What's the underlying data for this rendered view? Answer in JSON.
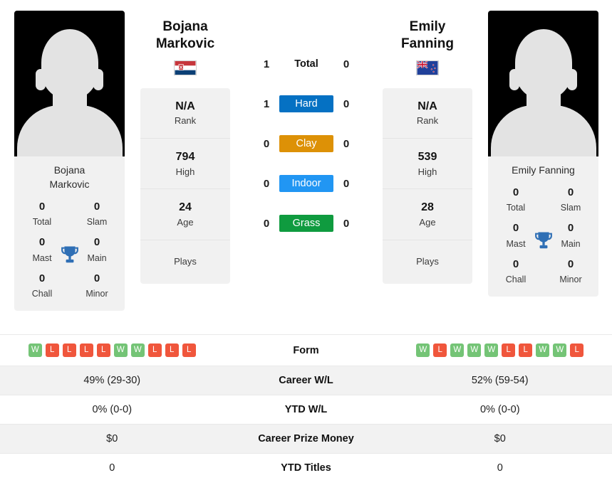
{
  "players": {
    "left": {
      "display_name": "Bojana Markovic",
      "first_name": "Bojana",
      "last_name": "Markovic",
      "photo_caption_line1": "Bojana",
      "photo_caption_line2": "Markovic",
      "flag": "serbia-flag",
      "rank": "N/A",
      "rank_label": "Rank",
      "high": "794",
      "high_label": "High",
      "age": "24",
      "age_label": "Age",
      "plays_label": "Plays",
      "titles": {
        "total": "0",
        "total_label": "Total",
        "slam": "0",
        "slam_label": "Slam",
        "mast": "0",
        "mast_label": "Mast",
        "main": "0",
        "main_label": "Main",
        "chall": "0",
        "chall_label": "Chall",
        "minor": "0",
        "minor_label": "Minor"
      },
      "form": [
        "W",
        "L",
        "L",
        "L",
        "L",
        "W",
        "W",
        "L",
        "L",
        "L"
      ],
      "career_wl": "49% (29-30)",
      "ytd_wl": "0% (0-0)",
      "career_prize_money": "$0",
      "ytd_titles": "0"
    },
    "right": {
      "display_name": "Emily Fanning",
      "first_name": "Emily",
      "last_name": "Fanning",
      "photo_caption_line1": "Emily Fanning",
      "flag": "new-zealand-flag",
      "rank": "N/A",
      "rank_label": "Rank",
      "high": "539",
      "high_label": "High",
      "age": "28",
      "age_label": "Age",
      "plays_label": "Plays",
      "titles": {
        "total": "0",
        "total_label": "Total",
        "slam": "0",
        "slam_label": "Slam",
        "mast": "0",
        "mast_label": "Mast",
        "main": "0",
        "main_label": "Main",
        "chall": "0",
        "chall_label": "Chall",
        "minor": "0",
        "minor_label": "Minor"
      },
      "form": [
        "W",
        "L",
        "W",
        "W",
        "W",
        "L",
        "L",
        "W",
        "W",
        "L"
      ],
      "career_wl": "52% (59-54)",
      "ytd_wl": "0% (0-0)",
      "career_prize_money": "$0",
      "ytd_titles": "0"
    }
  },
  "head_to_head": [
    {
      "label": "Total",
      "left": "1",
      "right": "0",
      "badge": false,
      "color": ""
    },
    {
      "label": "Hard",
      "left": "1",
      "right": "0",
      "badge": true,
      "color": "#0571c3"
    },
    {
      "label": "Clay",
      "left": "0",
      "right": "0",
      "badge": true,
      "color": "#dd9106"
    },
    {
      "label": "Indoor",
      "left": "0",
      "right": "0",
      "badge": true,
      "color": "#2196f3"
    },
    {
      "label": "Grass",
      "left": "0",
      "right": "0",
      "badge": true,
      "color": "#0f9b3f"
    }
  ],
  "comparison_rows": [
    {
      "label": "Form",
      "left": "",
      "right": "",
      "type": "form",
      "alt": false
    },
    {
      "label": "Career W/L",
      "left": "49% (29-30)",
      "right": "52% (59-54)",
      "type": "text",
      "alt": true
    },
    {
      "label": "YTD W/L",
      "left": "0% (0-0)",
      "right": "0% (0-0)",
      "type": "text",
      "alt": false
    },
    {
      "label": "Career Prize Money",
      "left": "$0",
      "right": "$0",
      "type": "text",
      "alt": true
    },
    {
      "label": "YTD Titles",
      "left": "0",
      "right": "0",
      "type": "text",
      "alt": false
    }
  ],
  "colors": {
    "hard": "#0571c3",
    "clay": "#dd9106",
    "indoor": "#2196f3",
    "grass": "#0f9b3f",
    "win": "#74c476",
    "loss": "#f0563c",
    "trophy": "#2f6fb5",
    "card_bg": "#f1f1f1"
  }
}
